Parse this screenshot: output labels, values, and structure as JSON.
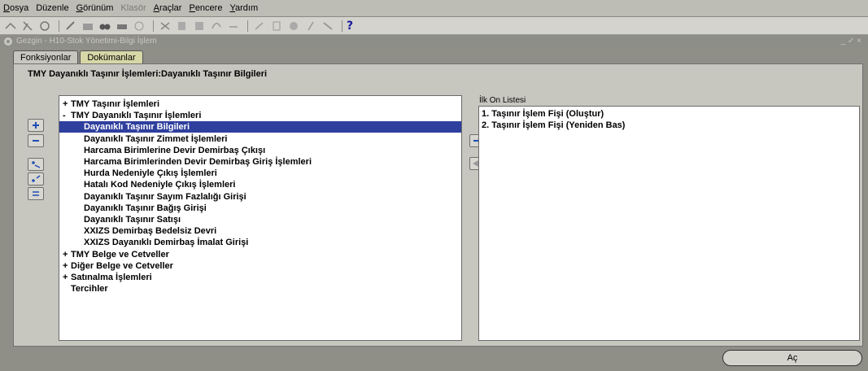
{
  "menu": {
    "items": [
      {
        "accel": "D",
        "rest": "osya",
        "disabled": false
      },
      {
        "accel": "",
        "rest": "Düzenle",
        "disabled": false
      },
      {
        "accel": "G",
        "rest": "örünüm",
        "disabled": false
      },
      {
        "accel": "",
        "rest": "Klasör",
        "disabled": true
      },
      {
        "accel": "A",
        "rest": "raçlar",
        "disabled": false
      },
      {
        "accel": "P",
        "rest": "encere",
        "disabled": false
      },
      {
        "accel": "Y",
        "rest": "ardım",
        "disabled": false
      }
    ]
  },
  "toolbar": {
    "help": "?"
  },
  "window": {
    "title": "Gezgin - H10-Stok Yönetimi-Bilgi İşlem",
    "controls": "_ ✓ ×"
  },
  "tabs": [
    {
      "label": "Fonksiyonlar",
      "active": true
    },
    {
      "label": "Dokümanlar",
      "active": false
    }
  ],
  "panel": {
    "title": "TMY Dayanıklı Taşınır İşlemleri:Dayanıklı Taşınır Bilgileri"
  },
  "tree": {
    "items": [
      {
        "exp": "+",
        "label": "TMY Taşınır İşlemleri",
        "level": 0,
        "selected": false
      },
      {
        "exp": "-",
        "label": "TMY Dayanıklı Taşınır İşlemleri",
        "level": 0,
        "selected": false
      },
      {
        "exp": "",
        "label": "Dayanıklı Taşınır Bilgileri",
        "level": 1,
        "selected": true
      },
      {
        "exp": "",
        "label": "Dayanıklı Taşınır Zimmet İşlemleri",
        "level": 1,
        "selected": false
      },
      {
        "exp": "",
        "label": "Harcama Birimlerine Devir Demirbaş Çıkışı",
        "level": 1,
        "selected": false
      },
      {
        "exp": "",
        "label": "Harcama Birimlerinden Devir Demirbaş Giriş İşlemleri",
        "level": 1,
        "selected": false
      },
      {
        "exp": "",
        "label": "Hurda Nedeniyle Çıkış İşlemleri",
        "level": 1,
        "selected": false
      },
      {
        "exp": "",
        "label": "Hatalı Kod Nedeniyle Çıkış İşlemleri",
        "level": 1,
        "selected": false
      },
      {
        "exp": "",
        "label": "Dayanıklı Taşınır Sayım Fazlalığı Girişi",
        "level": 1,
        "selected": false
      },
      {
        "exp": "",
        "label": "Dayanıklı Taşınır Bağış Girişi",
        "level": 1,
        "selected": false
      },
      {
        "exp": "",
        "label": "Dayanıklı Taşınır Satışı",
        "level": 1,
        "selected": false
      },
      {
        "exp": "",
        "label": "XXIZS Demirbaş Bedelsiz Devri",
        "level": 1,
        "selected": false
      },
      {
        "exp": "",
        "label": "XXIZS Dayanıklı Demirbaş İmalat Girişi",
        "level": 1,
        "selected": false
      },
      {
        "exp": "+",
        "label": "TMY Belge ve Cetveller",
        "level": 0,
        "selected": false
      },
      {
        "exp": "+",
        "label": "Diğer Belge ve Cetveller",
        "level": 0,
        "selected": false
      },
      {
        "exp": "+",
        "label": "Satınalma İşlemleri",
        "level": 0,
        "selected": false
      },
      {
        "exp": "",
        "label": "Tercihler",
        "level": 0,
        "selected": false
      }
    ]
  },
  "top_ten": {
    "label": "İlk On Listesi",
    "items": [
      "1. Taşınır İşlem Fişi (Oluştur)",
      "2. Taşınır İşlem Fişi (Yeniden Bas)"
    ]
  },
  "buttons": {
    "open": "Aç"
  },
  "colors": {
    "selection": "#2e3f9e",
    "arrow_active": "#1f4fb5",
    "arrow_disabled": "#9a9a9a"
  }
}
